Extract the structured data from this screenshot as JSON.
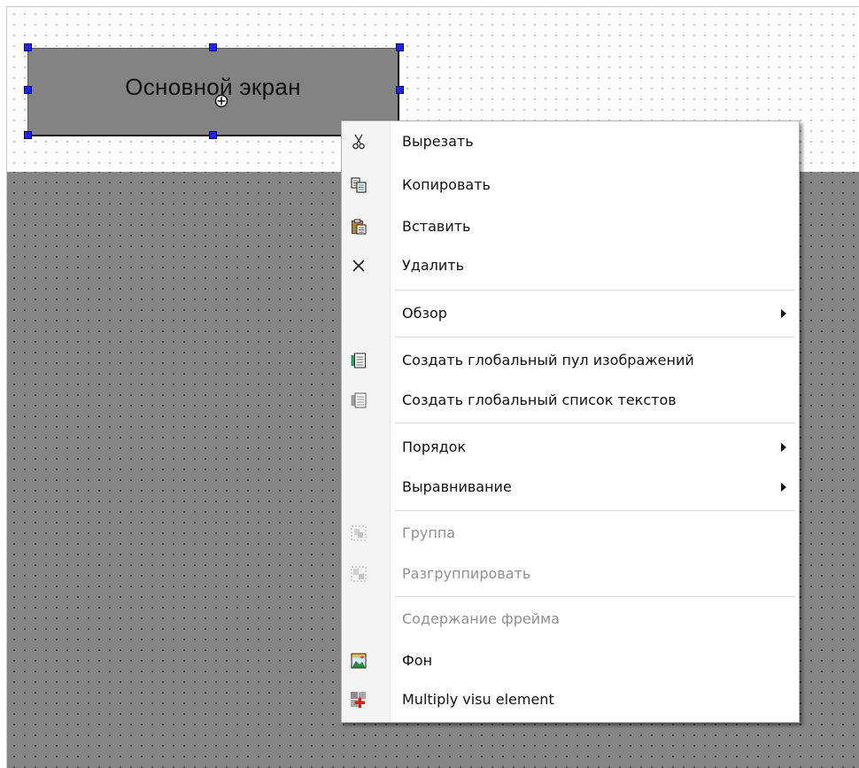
{
  "element": {
    "label": "Основной экран"
  },
  "menu": {
    "items": [
      {
        "label": "Вырезать",
        "icon": "scissors-icon",
        "enabled": true
      },
      {
        "label": "Копировать",
        "icon": "copy-icon",
        "enabled": true
      },
      {
        "label": "Вставить",
        "icon": "paste-icon",
        "enabled": true
      },
      {
        "label": "Удалить",
        "icon": "delete-x-icon",
        "enabled": true
      },
      {
        "label": "Обзор",
        "submenu": true,
        "enabled": true
      },
      {
        "label": "Создать глобальный пул изображений",
        "icon": "image-pool-icon",
        "enabled": true
      },
      {
        "label": "Создать глобальный список текстов",
        "icon": "text-list-icon",
        "enabled": true
      },
      {
        "label": "Порядок",
        "submenu": true,
        "enabled": true
      },
      {
        "label": "Выравнивание",
        "submenu": true,
        "enabled": true
      },
      {
        "label": "Группа",
        "icon": "group-icon",
        "enabled": false
      },
      {
        "label": "Разгруппировать",
        "icon": "ungroup-icon",
        "enabled": false
      },
      {
        "label": "Содержание фрейма",
        "enabled": false
      },
      {
        "label": "Фон",
        "icon": "background-image-icon",
        "enabled": true
      },
      {
        "label": "Multiply visu element",
        "icon": "multiply-element-icon",
        "enabled": true
      }
    ]
  },
  "colors": {
    "selection_handle": "#2222ee",
    "element_fill": "#838383",
    "dark_area": "#858585"
  }
}
